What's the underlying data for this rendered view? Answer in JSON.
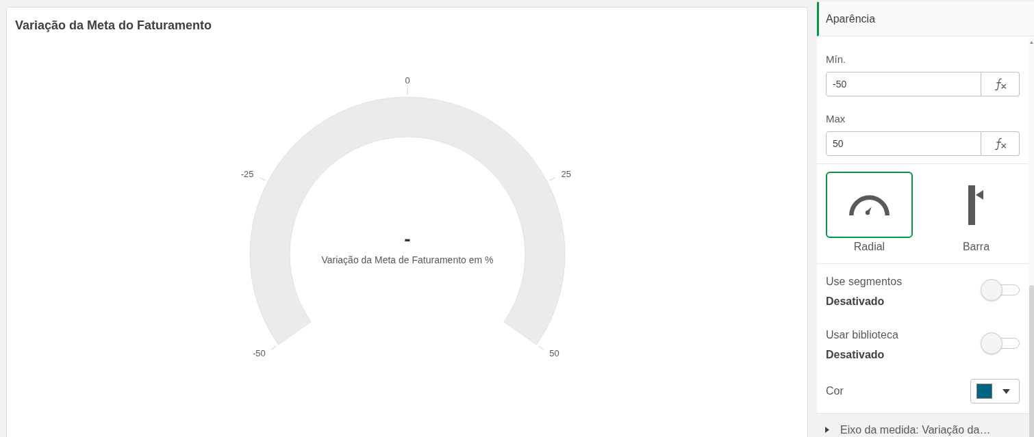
{
  "chart": {
    "title": "Variação da Meta do Faturamento",
    "gauge": {
      "ticks": [
        "-50",
        "-25",
        "0",
        "25",
        "50"
      ],
      "value": "-",
      "label": "Variação da Meta de Faturamento em %"
    }
  },
  "panel": {
    "sections": [
      {
        "title": "Aparência",
        "expanded": true,
        "fields": [
          {
            "label": "Mín.",
            "value": "-50"
          },
          {
            "label": "Max",
            "value": "50"
          }
        ],
        "gauge_types": [
          {
            "kind": "radial",
            "label": "Radial",
            "selected": true
          },
          {
            "kind": "bar",
            "label": "Barra",
            "selected": false
          }
        ],
        "switches": [
          {
            "label": "Use segmentos",
            "state": "Desativado",
            "on": false
          },
          {
            "label": "Usar biblioteca",
            "state": "Desativado",
            "on": false
          }
        ],
        "color_picker": {
          "label": "Cor",
          "color": "#006580"
        }
      },
      {
        "title": "Eixo da medida: Variação da…",
        "expanded": false
      }
    ]
  }
}
